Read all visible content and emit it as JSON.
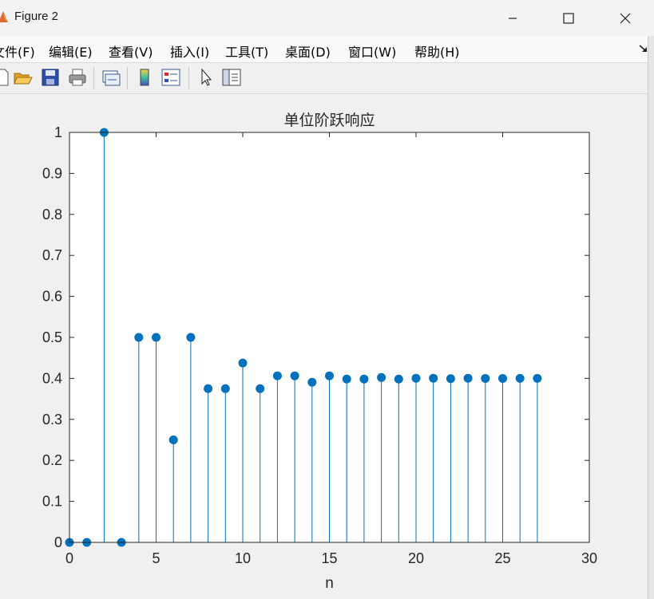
{
  "window": {
    "title": "Figure 2"
  },
  "menu": {
    "items": [
      "文件(F)",
      "编辑(E)",
      "查看(V)",
      "插入(I)",
      "工具(T)",
      "桌面(D)",
      "窗口(W)",
      "帮助(H)"
    ]
  },
  "toolbar": {
    "icons": [
      "new-figure-icon",
      "open-file-icon",
      "save-icon",
      "print-icon",
      "link-plot-icon",
      "insert-colorbar-icon",
      "insert-legend-icon",
      "edit-plot-icon",
      "property-inspector-icon"
    ]
  },
  "colors": {
    "stem": "#0072BD",
    "marker": "#0072BD",
    "axes_bg": "#ffffff",
    "figure_bg": "#f0f0f0"
  },
  "chart_data": {
    "type": "stem",
    "title": "单位阶跃响应",
    "xlabel": "n",
    "ylabel": "",
    "xlim": [
      0,
      30
    ],
    "ylim": [
      0,
      1
    ],
    "xticks": [
      0,
      5,
      10,
      15,
      20,
      25,
      30
    ],
    "yticks": [
      0,
      0.1,
      0.2,
      0.3,
      0.4,
      0.5,
      0.6,
      0.7,
      0.8,
      0.9,
      1
    ],
    "ytick_labels": [
      "0",
      "0.1",
      "0.2",
      "0.3",
      "0.4",
      "0.5",
      "0.6",
      "0.7",
      "0.8",
      "0.9",
      "1"
    ],
    "grid": false,
    "x": [
      0,
      1,
      2,
      3,
      4,
      5,
      6,
      7,
      8,
      9,
      10,
      11,
      12,
      13,
      14,
      15,
      16,
      17,
      18,
      19,
      20,
      21,
      22,
      23,
      24,
      25,
      26,
      27
    ],
    "y": [
      0,
      0,
      1,
      0,
      0.5,
      0.5,
      0.25,
      0.5,
      0.375,
      0.375,
      0.4375,
      0.375,
      0.40625,
      0.40625,
      0.390625,
      0.40625,
      0.3984,
      0.3984,
      0.4023,
      0.3984,
      0.4004,
      0.4004,
      0.3994,
      0.4004,
      0.3999,
      0.3999,
      0.4001,
      0.4
    ]
  }
}
